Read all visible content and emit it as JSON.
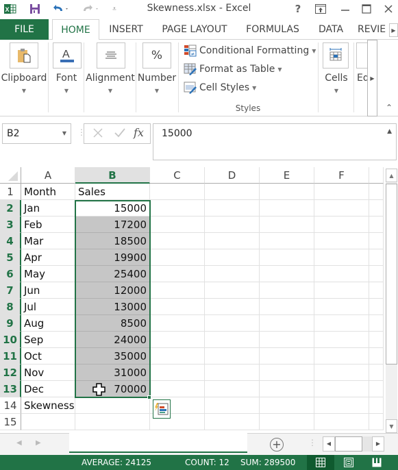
{
  "window": {
    "title": "Skewness.xlsx - Excel",
    "help_label": "?",
    "controls": [
      "ribbon-display-options",
      "minimize",
      "maximize",
      "close"
    ]
  },
  "quick_access": {
    "icons": [
      "excel-logo-icon",
      "save-icon",
      "undo-icon",
      "redo-icon",
      "customize-qat-icon"
    ]
  },
  "tabs": [
    {
      "label": "FILE",
      "active": false
    },
    {
      "label": "HOME",
      "active": true
    },
    {
      "label": "INSERT",
      "active": false
    },
    {
      "label": "PAGE LAYOUT",
      "active": false
    },
    {
      "label": "FORMULAS",
      "active": false
    },
    {
      "label": "DATA",
      "active": false
    },
    {
      "label": "REVIE",
      "active": false
    }
  ],
  "ribbon": {
    "groups": [
      {
        "label": "Clipboard",
        "icon": "clipboard-icon"
      },
      {
        "label": "Font",
        "icon": "font-color-icon"
      },
      {
        "label": "Alignment",
        "icon": "align-center-icon"
      },
      {
        "label": "Number",
        "icon": "percent-icon",
        "glyph": "%"
      }
    ],
    "styles": {
      "label": "Styles",
      "items": [
        {
          "label": "Conditional Formatting",
          "icon": "conditional-formatting-icon"
        },
        {
          "label": "Format as Table",
          "icon": "format-as-table-icon"
        },
        {
          "label": "Cell Styles",
          "icon": "cell-styles-icon"
        }
      ]
    },
    "cells": {
      "label": "Cells",
      "icon": "cells-icon"
    },
    "editing": {
      "label": "Ed"
    }
  },
  "formula_bar": {
    "name_box": "B2",
    "fx_label": "fx",
    "value": "15000"
  },
  "grid": {
    "columns": [
      "A",
      "B",
      "C",
      "D",
      "E",
      "F"
    ],
    "selected_column": "B",
    "rows": [
      {
        "n": "1",
        "a": "Month",
        "b": "Sales"
      },
      {
        "n": "2",
        "a": "Jan",
        "b": "15000"
      },
      {
        "n": "3",
        "a": "Feb",
        "b": "17200"
      },
      {
        "n": "4",
        "a": "Mar",
        "b": "18500"
      },
      {
        "n": "5",
        "a": "Apr",
        "b": "19900"
      },
      {
        "n": "6",
        "a": "May",
        "b": "25400"
      },
      {
        "n": "7",
        "a": "Jun",
        "b": "12000"
      },
      {
        "n": "8",
        "a": "Jul",
        "b": "13000"
      },
      {
        "n": "9",
        "a": "Aug",
        "b": "8500"
      },
      {
        "n": "10",
        "a": "Sep",
        "b": "24000"
      },
      {
        "n": "11",
        "a": "Oct",
        "b": "35000"
      },
      {
        "n": "12",
        "a": "Nov",
        "b": "31000"
      },
      {
        "n": "13",
        "a": "Dec",
        "b": "70000"
      },
      {
        "n": "14",
        "a": "Skewness",
        "b": ""
      },
      {
        "n": "15",
        "a": "",
        "b": ""
      }
    ],
    "selection": "B2:B13",
    "active_cell": "B2"
  },
  "status_bar": {
    "average": "AVERAGE: 24125",
    "count": "COUNT: 12",
    "sum": "SUM: 289500",
    "views": [
      "normal-view",
      "page-layout-view",
      "page-break-preview"
    ],
    "active_view": "normal-view"
  },
  "colors": {
    "accent": "#217346",
    "selection_fill": "#c6c6c6",
    "header_selected": "#e1e1e1"
  }
}
